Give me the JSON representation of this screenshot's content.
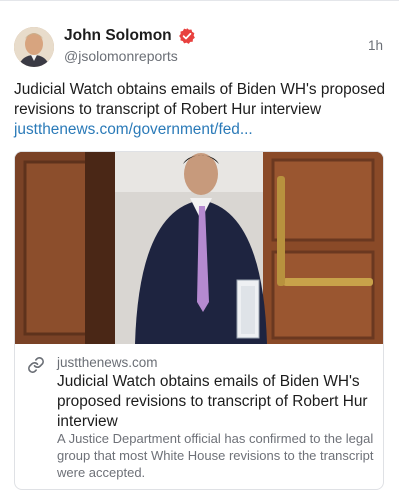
{
  "post": {
    "author": {
      "display_name": "John Solomon",
      "handle": "@jsolomonreports",
      "verified_icon": "verified-badge-icon",
      "badge_color": "#e8413f"
    },
    "timestamp": "1h",
    "text": "Judicial Watch obtains emails of Biden WH's proposed revisions to transcript of Robert Hur interview",
    "link_text": "justthenews.com/government/fed...",
    "link_color": "#2a7ab8"
  },
  "card": {
    "domain": "justthenews.com",
    "title": "Judicial Watch obtains emails of Biden WH's proposed revisions to transcript of Robert Hur interview",
    "description": "A Justice Department official has confirmed to the legal group that most White House revisions to the transcript were accepted.",
    "icon": "link-icon"
  }
}
